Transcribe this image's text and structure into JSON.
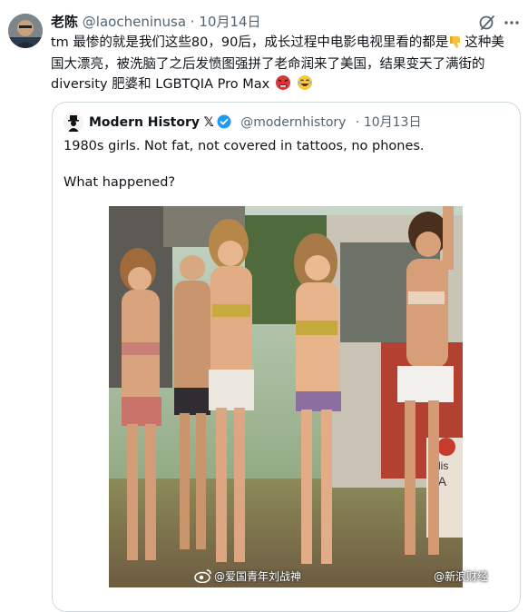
{
  "post": {
    "author_name": "老陈",
    "author_handle": "@laocheninusa",
    "separator": "·",
    "date": "10月14日",
    "text_line1_a": "tm 最惨的就是我们这些80，90后，成长过程中电影电视里看的都是",
    "text_line1_b": "这种美",
    "text_line2": "国大漂亮，被洗脑了之后发愤图强拼了老命润来了美国，结果变天了满街的",
    "text_line3": "diversity 肥婆和 LGBTQIA Pro Max",
    "icons": [
      "grok-icon",
      "more-icon",
      "thumb-down-emoji",
      "angry-face-emoji",
      "laughing-face-emoji"
    ]
  },
  "quoted_post": {
    "author_name": "Modern History",
    "x_mark": "𝕏",
    "author_handle": "@modernhistory",
    "separator": "·",
    "date": "10月13日",
    "text_line1": "1980s girls. Not fat, not covered in tattoos, no phones.",
    "text_line2": "What happened?",
    "image_sign_text": [
      "Alis",
      "FA"
    ]
  },
  "watermark": {
    "left_text": "@爱国青年刘战神",
    "right_text": "@新浪财经"
  },
  "colors": {
    "text": "#0f1419",
    "secondary": "#536471",
    "border": "#cfd9de",
    "verified_blue": "#1d9bf0"
  }
}
